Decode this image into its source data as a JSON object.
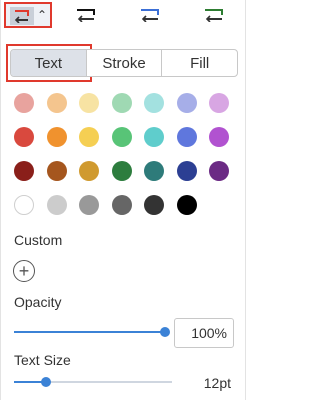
{
  "tabs": {
    "text": "Text",
    "stroke": "Stroke",
    "fill": "Fill"
  },
  "arrow_styles": [
    {
      "name": "arrow-style-red",
      "color": "#e0392d",
      "selected": true
    },
    {
      "name": "arrow-style-black",
      "color": "#111111",
      "selected": false
    },
    {
      "name": "arrow-style-blue",
      "color": "#3b6fd6",
      "selected": false
    },
    {
      "name": "arrow-style-green",
      "color": "#2e7d32",
      "selected": false
    }
  ],
  "swatch_rows": [
    [
      "#e8a39e",
      "#f4c58e",
      "#f7e3a3",
      "#9fd9b3",
      "#a3e1e0",
      "#a6aee8",
      "#d8a6e3"
    ],
    [
      "#d9493e",
      "#f0922e",
      "#f5cf53",
      "#58c477",
      "#5fcdcc",
      "#5f77dd",
      "#b152d0"
    ],
    [
      "#8a1f1a",
      "#a5561e",
      "#d09a2f",
      "#2d7d3e",
      "#2e7b7a",
      "#2c3f93",
      "#6b2a84"
    ],
    [
      "#ffffff",
      "#cccccc",
      "#999999",
      "#666666",
      "#333333",
      "#000000"
    ]
  ],
  "labels": {
    "custom": "Custom",
    "opacity": "Opacity",
    "text_size": "Text Size"
  },
  "opacity": {
    "value_text": "100%",
    "fraction": 1.0
  },
  "text_size": {
    "value_text": "12pt",
    "fraction": 0.2
  },
  "colors": {
    "accent": "#3b82d6",
    "highlight": "#e0392d"
  }
}
